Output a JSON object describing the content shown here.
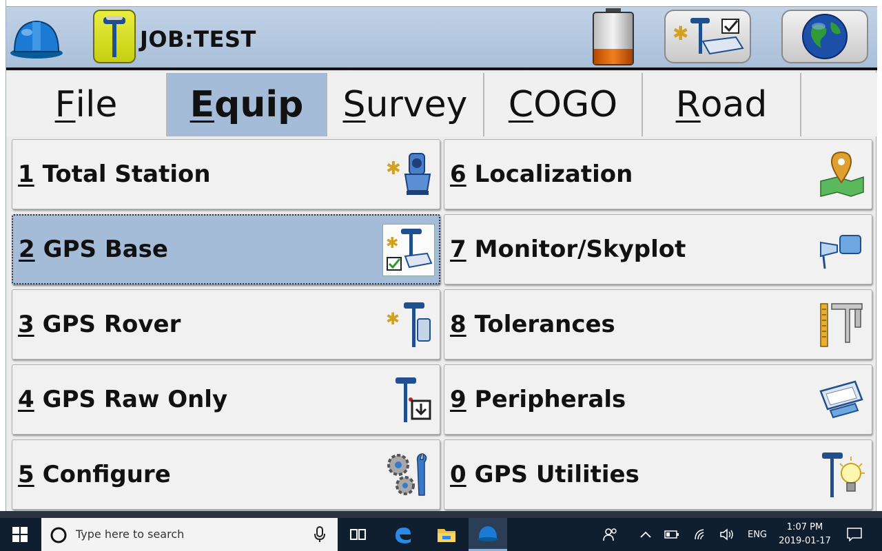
{
  "header": {
    "job_title": "JOB:TEST",
    "battery_level": 0.3
  },
  "tabs": [
    {
      "mnemonic": "F",
      "rest": "ile",
      "active": false
    },
    {
      "mnemonic": "E",
      "rest": "quip",
      "active": true
    },
    {
      "mnemonic": "S",
      "rest": "urvey",
      "active": false
    },
    {
      "mnemonic": "C",
      "rest": "OGO",
      "active": false
    },
    {
      "mnemonic": "R",
      "rest": "oad",
      "active": false
    }
  ],
  "menu": {
    "items": [
      {
        "num": "1",
        "label": "Total Station",
        "icon": "total-station-icon"
      },
      {
        "num": "2",
        "label": "GPS Base",
        "icon": "gps-base-icon",
        "selected": true
      },
      {
        "num": "3",
        "label": "GPS Rover",
        "icon": "gps-rover-icon"
      },
      {
        "num": "4",
        "label": "GPS Raw Only",
        "icon": "gps-raw-icon"
      },
      {
        "num": "5",
        "label": "Configure",
        "icon": "configure-icon"
      },
      {
        "num": "6",
        "label": "Localization",
        "icon": "localization-icon"
      },
      {
        "num": "7",
        "label": "Monitor/Skyplot",
        "icon": "skyplot-icon"
      },
      {
        "num": "8",
        "label": "Tolerances",
        "icon": "tolerances-icon"
      },
      {
        "num": "9",
        "label": "Peripherals",
        "icon": "peripherals-icon"
      },
      {
        "num": "0",
        "label": "GPS Utilities",
        "icon": "gps-utilities-icon"
      }
    ]
  },
  "taskbar": {
    "search_placeholder": "Type here to search",
    "language": "ENG",
    "time": "1:07 PM",
    "date": "2019-01-17"
  },
  "colors": {
    "header_bg": "#b5c8df",
    "active_tab": "#a4bcd8",
    "selected_item": "#a4bcd8",
    "taskbar": "#0f1f30"
  }
}
